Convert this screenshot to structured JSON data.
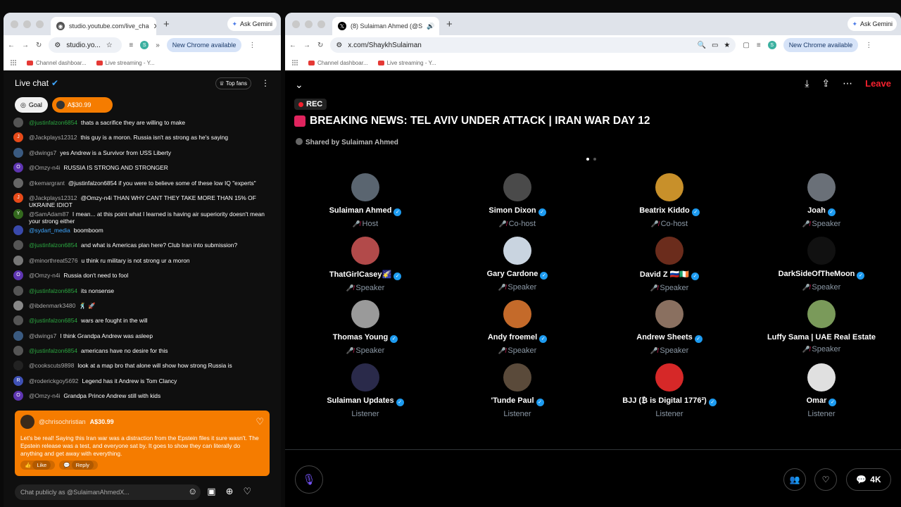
{
  "left_window": {
    "tab_title": "studio.youtube.com/live_cha",
    "new_tab": "+",
    "gemini": "Ask Gemini",
    "url": "studio.yo...",
    "chrome_available": "New Chrome available",
    "profile": "S",
    "bookmarks": [
      "Channel dashboar...",
      "Live streaming - Y..."
    ]
  },
  "right_window": {
    "tab_title": "(8) Sulaiman Ahmed (@S",
    "new_tab": "+",
    "gemini": "Ask Gemini",
    "url": "x.com/ShaykhSulaiman",
    "chrome_available": "New Chrome available",
    "profile": "S",
    "bookmarks": [
      "Channel dashboar...",
      "Live streaming - Y..."
    ]
  },
  "live_chat": {
    "title": "Live chat",
    "top_fans": "Top fans",
    "goal": "Goal",
    "amount_chip": "A$30.99",
    "messages": [
      {
        "author": "@justinfalzon6854",
        "text": "thats a sacrifice they are willing to make",
        "color": "#2ba640",
        "av": "#555"
      },
      {
        "author": "@Jackplays12312",
        "text": "this guy is a moron. Russia isn't as strong as he's saying",
        "color": "#aaa",
        "av": "#e64a19",
        "initial": "J"
      },
      {
        "author": "@dwings7",
        "text": "yes Andrew is a Survivor from USS Liberty",
        "color": "#aaa",
        "av": "#3a5a80"
      },
      {
        "author": "@Omzy-n4i",
        "text": "RUSSIA IS STRONG AND STRONGER",
        "color": "#aaa",
        "av": "#5e35b1",
        "initial": "O"
      },
      {
        "author": "@kemargrant",
        "text": "@justinfalzon6854 if you were to believe some of these low IQ \"experts\"",
        "color": "#aaa",
        "av": "#666"
      },
      {
        "author": "@Jackplays12312",
        "text": "@Omzy-n4i THAN WHY CANT THEY TAKE MORE THAN 15% OF UKRAINE IDIOT",
        "color": "#aaa",
        "av": "#e64a19",
        "initial": "J"
      },
      {
        "author": "@SamAdam87",
        "text": "I mean... at this point what I learned is having air superiority doesn't mean your strong either",
        "color": "#aaa",
        "av": "#33691e",
        "initial": "Y"
      },
      {
        "author": "@sydart_media",
        "text": "boomboom",
        "color": "#3ea6ff",
        "av": "#3949ab"
      },
      {
        "author": "@justinfalzon6854",
        "text": "and what is Americas plan here? Club Iran into submission?",
        "color": "#2ba640",
        "av": "#555"
      },
      {
        "author": "@minorthreat5276",
        "text": "u think ru military is not strong ur a moron",
        "color": "#aaa",
        "av": "#777"
      },
      {
        "author": "@Omzy-n4i",
        "text": "Russia don't need to fool",
        "color": "#aaa",
        "av": "#5e35b1",
        "initial": "O"
      },
      {
        "author": "@justinfalzon6854",
        "text": "its nonsense",
        "color": "#2ba640",
        "av": "#555"
      },
      {
        "author": "@ibdenmark3480",
        "text": "🕺 🚀",
        "color": "#aaa",
        "av": "#888"
      },
      {
        "author": "@justinfalzon6854",
        "text": "wars are fought in the will",
        "color": "#2ba640",
        "av": "#555"
      },
      {
        "author": "@dwings7",
        "text": "I think Grandpa Andrew was asleep",
        "color": "#aaa",
        "av": "#3a5a80"
      },
      {
        "author": "@justinfalzon6854",
        "text": "americans have no desire for this",
        "color": "#2ba640",
        "av": "#555"
      },
      {
        "author": "@cookscuts9898",
        "text": "look at a map bro that alone will show how strong Russia is",
        "color": "#aaa",
        "av": "#222"
      },
      {
        "author": "@roderickgoy5692",
        "text": "Legend has it Andrew is Tom Clancy",
        "color": "#aaa",
        "av": "#3f51b5",
        "initial": "R"
      },
      {
        "author": "@Omzy-n4i",
        "text": "Grandpa Prince Andrew still with kids",
        "color": "#aaa",
        "av": "#5e35b1",
        "initial": "O"
      }
    ],
    "superchat": {
      "author": "@chrisochristian",
      "amount": "A$30.99",
      "text": "Let's be real! Saying this Iran war was a distraction from the Epstein files it sure wasn't. The Epstein release was a test, and everyone sat by. It goes to show they can literally do anything and get away with everything.",
      "like": "Like",
      "reply": "Reply"
    },
    "input_placeholder": "Chat publicly as @SulaimanAhmedX..."
  },
  "space": {
    "rec": "REC",
    "title": "BREAKING NEWS: TEL AVIV UNDER ATTACK | IRAN WAR DAY 12",
    "shared_by": "Shared by Sulaiman Ahmed",
    "leave": "Leave",
    "listener_count": "4K",
    "speakers": [
      {
        "name": "Sulaiman Ahmed",
        "role": "Host",
        "verified": true,
        "av": "#5a6570"
      },
      {
        "name": "Simon Dixon",
        "role": "Co-host",
        "verified": true,
        "av": "#4a4a4a"
      },
      {
        "name": "Beatrix Kiddo",
        "role": "Co-host",
        "verified": true,
        "av": "#c8902a"
      },
      {
        "name": "Joah",
        "role": "Speaker",
        "verified": true,
        "av": "#6a7078"
      },
      {
        "name": "ThatGirlCasey🌠",
        "role": "Speaker",
        "verified": true,
        "av": "#b24a4a"
      },
      {
        "name": "Gary Cardone",
        "role": "Speaker",
        "verified": true,
        "av": "#c9d4e0"
      },
      {
        "name": "David Z 🇷🇺🇮🇪",
        "role": "Speaker",
        "verified": true,
        "av": "#6b2c1c"
      },
      {
        "name": "DarkSideOfTheMoon",
        "role": "Speaker",
        "verified": true,
        "av": "#111"
      },
      {
        "name": "Thomas Young",
        "role": "Speaker",
        "verified": true,
        "av": "#9a9a9a"
      },
      {
        "name": "Andy froemel",
        "role": "Speaker",
        "verified": true,
        "av": "#c46a2a"
      },
      {
        "name": "Andrew Sheets",
        "role": "Speaker",
        "verified": true,
        "av": "#8a7060"
      },
      {
        "name": "Luffy Sama | UAE Real Estate",
        "role": "Speaker",
        "verified": false,
        "av": "#7a9a5a"
      },
      {
        "name": "Sulaiman Updates",
        "role": "Listener",
        "verified": true,
        "av": "#2a2a4a"
      },
      {
        "name": "'Tunde Paul",
        "role": "Listener",
        "verified": true,
        "av": "#5a4a3a"
      },
      {
        "name": "BJJ (₿ is Digital 1776²)",
        "role": "Listener",
        "verified": true,
        "av": "#d62828"
      },
      {
        "name": "Omar",
        "role": "Listener",
        "verified": true,
        "av": "#e0e0e0"
      }
    ]
  }
}
